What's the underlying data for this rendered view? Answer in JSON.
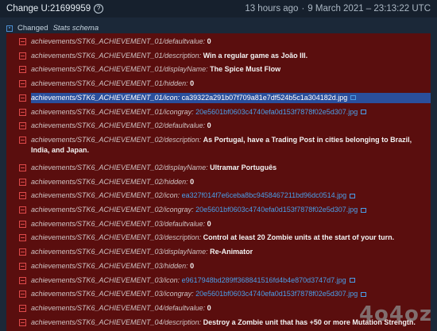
{
  "header": {
    "title": "Change U:21699959",
    "help_icon": "?",
    "relative_time": "13 hours ago",
    "separator": "·",
    "datetime": "9 March 2021 – 23:13:22 UTC"
  },
  "group": {
    "prefix": "Changed",
    "name": "Stats schema"
  },
  "rows": [
    {
      "key": "achievements/STK6_ACHIEVEMENT_01/defaultvalue:",
      "value": "0",
      "type": "text"
    },
    {
      "key": "achievements/STK6_ACHIEVEMENT_01/description:",
      "value": "Win a regular game as João III.",
      "type": "text"
    },
    {
      "key": "achievements/STK6_ACHIEVEMENT_01/displayName:",
      "value": "The Spice Must Flow",
      "type": "text"
    },
    {
      "key": "achievements/STK6_ACHIEVEMENT_01/hidden:",
      "value": "0",
      "type": "text"
    },
    {
      "key": "achievements/STK6_ACHIEVEMENT_01/icon:",
      "value": "ca39322a291b07f709a81e7df524b5c1a304182d.jpg",
      "type": "link",
      "highlight": true
    },
    {
      "key": "achievements/STK6_ACHIEVEMENT_01/icongray:",
      "value": "20e5601bf0603c4740efa0d153f7878f02e5d307.jpg",
      "type": "link"
    },
    {
      "key": "achievements/STK6_ACHIEVEMENT_02/defaultvalue:",
      "value": "0",
      "type": "text"
    },
    {
      "key": "achievements/STK6_ACHIEVEMENT_02/description:",
      "value": "As Portugal, have a Trading Post in cities belonging to Brazil, India, and Japan.",
      "type": "text",
      "wrap": true
    },
    {
      "key": "achievements/STK6_ACHIEVEMENT_02/displayName:",
      "value": "Ultramar Português",
      "type": "text"
    },
    {
      "key": "achievements/STK6_ACHIEVEMENT_02/hidden:",
      "value": "0",
      "type": "text"
    },
    {
      "key": "achievements/STK6_ACHIEVEMENT_02/icon:",
      "value": "ea327f014f7e6ceba8bc9458467211bd96dc0514.jpg",
      "type": "link"
    },
    {
      "key": "achievements/STK6_ACHIEVEMENT_02/icongray:",
      "value": "20e5601bf0603c4740efa0d153f7878f02e5d307.jpg",
      "type": "link"
    },
    {
      "key": "achievements/STK6_ACHIEVEMENT_03/defaultvalue:",
      "value": "0",
      "type": "text"
    },
    {
      "key": "achievements/STK6_ACHIEVEMENT_03/description:",
      "value": "Control at least 20 Zombie units at the start of your turn.",
      "type": "text"
    },
    {
      "key": "achievements/STK6_ACHIEVEMENT_03/displayName:",
      "value": "Re-Animator",
      "type": "text"
    },
    {
      "key": "achievements/STK6_ACHIEVEMENT_03/hidden:",
      "value": "0",
      "type": "text"
    },
    {
      "key": "achievements/STK6_ACHIEVEMENT_03/icon:",
      "value": "e9617948bd289ff368841516fd4b4e870d3747d7.jpg",
      "type": "link"
    },
    {
      "key": "achievements/STK6_ACHIEVEMENT_03/icongray:",
      "value": "20e5601bf0603c4740efa0d153f7878f02e5d307.jpg",
      "type": "link"
    },
    {
      "key": "achievements/STK6_ACHIEVEMENT_04/defaultvalue:",
      "value": "0",
      "type": "text"
    },
    {
      "key": "achievements/STK6_ACHIEVEMENT_04/description:",
      "value": "Destroy a Zombie unit that has +50 or more Mutation Strength.",
      "type": "text"
    }
  ],
  "watermark": "4o4oz.com",
  "colors": {
    "background": "#1b2838",
    "removed_panel": "#5a0e0e",
    "remove_icon": "#e04a4a",
    "link": "#4a9ee8",
    "selection": "#2a4f9c"
  },
  "icons": {
    "help": "help-icon",
    "group": "collapse-box-icon",
    "row": "minus-box-icon",
    "external": "external-link-icon"
  }
}
